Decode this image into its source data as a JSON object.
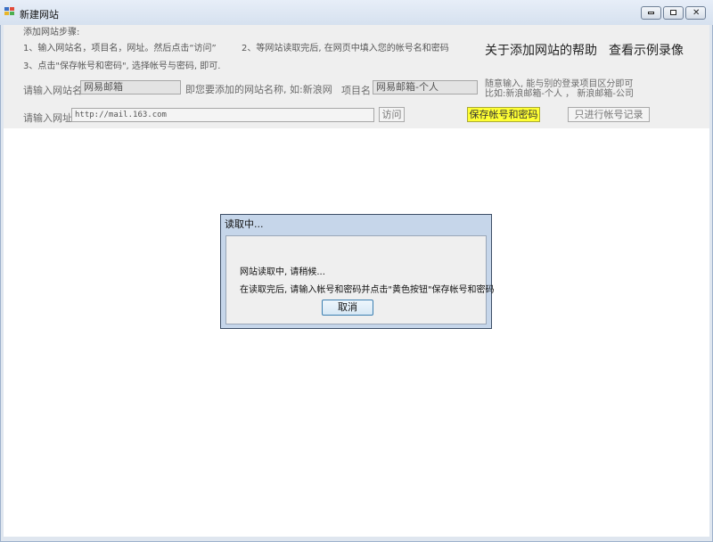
{
  "window": {
    "title": "新建网站"
  },
  "steps": {
    "title": "添加网站步骤:",
    "line1": "1、输入网站名，项目名，网址。然后点击“访问”",
    "line2": "2、等网站读取完后, 在网页中填入您的帐号名和密码",
    "line3": "3、点击\"保存帐号和密码\", 选择帐号与密码, 即可."
  },
  "links": {
    "help": "关于添加网站的帮助",
    "demo": "查看示例录像"
  },
  "form": {
    "site_label": "请输入网站名",
    "site_value": "网易邮箱",
    "site_hint": "即您要添加的网站名称, 如:新浪网",
    "project_label": "项目名",
    "project_value": "网易邮箱-个人",
    "project_hint1": "随意输入, 能与别的登录项目区分即可",
    "project_hint2": "比如:新浪邮箱-个人 ，  新浪邮箱-公司",
    "url_label": "请输入网址",
    "url_value": "http://mail.163.com"
  },
  "buttons": {
    "visit": "访问",
    "save": "保存帐号和密码",
    "record_only": "只进行帐号记录"
  },
  "dialog": {
    "title": "读取中...",
    "message1": "网站读取中, 请稍候...",
    "message2": "在读取完后, 请输入帐号和密码并点击\"黄色按钮\"保存帐号和密码",
    "cancel": "取消"
  },
  "colors": {
    "save_button": "#ffff33",
    "titlebar": "#dfe6ef",
    "dialog_frame": "#c6d6ea"
  }
}
